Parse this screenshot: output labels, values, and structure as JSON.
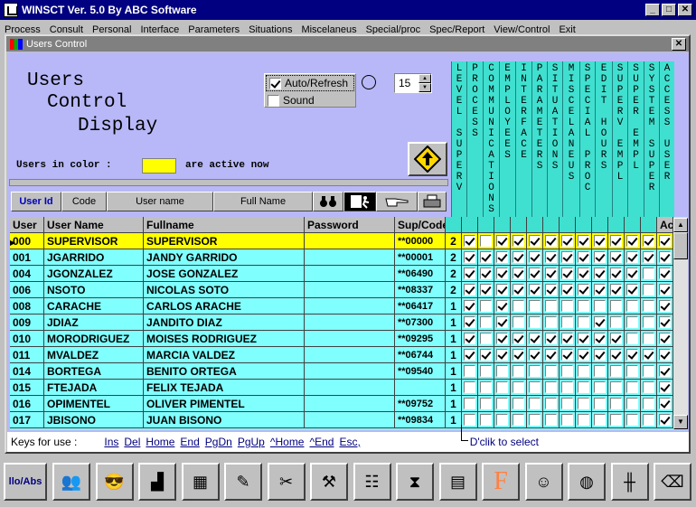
{
  "window": {
    "title": "WINSCT   Ver. 5.0  By ABC Software",
    "min": "_",
    "max": "□",
    "close": "✕"
  },
  "menu": [
    "Process",
    "Consult",
    "Personal",
    "Interface",
    "Parameters",
    "Situations",
    "Miscelaneus",
    "Special/proc",
    "Spec/Report",
    "View/Control",
    "Exit"
  ],
  "child": {
    "title": "Users Control",
    "close": "✕"
  },
  "heading": {
    "line1": "Users",
    "line2": "Control",
    "line3": "Display"
  },
  "options": {
    "auto_refresh": "Auto/Refresh",
    "sound": "Sound",
    "interval": "15"
  },
  "legend": {
    "prefix": "Users in color :",
    "suffix": "are active now",
    "color": "#ffff00"
  },
  "buttons": {
    "user_id": "User Id",
    "code": "Code",
    "user_name": "User name",
    "full_name": "Full Name"
  },
  "perm_headers": [
    "LEVEL SUPERV",
    "PROCESS",
    "COMMUNICATIONS",
    "EMPLOYEES",
    "INTERFACE",
    "PARAMETERS",
    "SITUATIONS",
    "MISCELANEUS",
    "SPECIAL PROC",
    "EDIT HOURS",
    "SUPERV EMPL",
    "SUPER EMPL",
    "SYSTEM SUPER",
    "ACCESS USER"
  ],
  "columns": {
    "user": "User",
    "user_name": "User Name",
    "fullname": "Fullname",
    "password": "Password",
    "sup_code": "Sup/Code",
    "access": "Ac"
  },
  "rows": [
    {
      "user": "000",
      "username": "SUPERVISOR",
      "fullname": "SUPERVISOR",
      "code": "**00000",
      "level": "2",
      "perms": [
        1,
        0,
        1,
        1,
        1,
        1,
        1,
        1,
        1,
        1,
        1,
        1,
        1
      ]
    },
    {
      "user": "001",
      "username": "JGARRIDO",
      "fullname": "JANDY GARRIDO",
      "code": "**00001",
      "level": "2",
      "perms": [
        1,
        1,
        1,
        1,
        1,
        1,
        1,
        1,
        1,
        1,
        1,
        1,
        1
      ]
    },
    {
      "user": "004",
      "username": "JGONZALEZ",
      "fullname": "JOSE GONZALEZ",
      "code": "**06490",
      "level": "2",
      "perms": [
        1,
        1,
        1,
        1,
        1,
        1,
        1,
        1,
        1,
        1,
        1,
        0,
        1
      ]
    },
    {
      "user": "006",
      "username": "NSOTO",
      "fullname": "NICOLAS SOTO",
      "code": "**08337",
      "level": "2",
      "perms": [
        1,
        1,
        1,
        1,
        1,
        1,
        1,
        1,
        1,
        1,
        1,
        0,
        1
      ]
    },
    {
      "user": "008",
      "username": "CARACHE",
      "fullname": "CARLOS ARACHE",
      "code": "**06417",
      "level": "1",
      "perms": [
        1,
        0,
        1,
        0,
        0,
        0,
        0,
        0,
        0,
        0,
        0,
        0,
        1
      ]
    },
    {
      "user": "009",
      "username": "JDIAZ",
      "fullname": "JANDITO DIAZ",
      "code": "**07300",
      "level": "1",
      "perms": [
        1,
        0,
        1,
        0,
        0,
        0,
        0,
        0,
        1,
        0,
        0,
        0,
        1
      ]
    },
    {
      "user": "010",
      "username": "MORODRIGUEZ",
      "fullname": "MOISES RODRIGUEZ",
      "code": "**09295",
      "level": "1",
      "perms": [
        1,
        0,
        1,
        1,
        1,
        1,
        1,
        1,
        1,
        1,
        0,
        0,
        1
      ]
    },
    {
      "user": "011",
      "username": "MVALDEZ",
      "fullname": "MARCIA VALDEZ",
      "code": "**06744",
      "level": "1",
      "perms": [
        1,
        1,
        1,
        1,
        1,
        1,
        1,
        1,
        1,
        1,
        1,
        1,
        1
      ]
    },
    {
      "user": "014",
      "username": "BORTEGA",
      "fullname": "BENITO ORTEGA",
      "code": "**09540",
      "level": "1",
      "perms": [
        0,
        0,
        0,
        0,
        0,
        0,
        0,
        0,
        0,
        0,
        0,
        0,
        1
      ]
    },
    {
      "user": "015",
      "username": "FTEJADA",
      "fullname": "FELIX TEJADA",
      "code": "",
      "level": "1",
      "perms": [
        0,
        0,
        0,
        0,
        0,
        0,
        0,
        0,
        0,
        0,
        0,
        0,
        1
      ]
    },
    {
      "user": "016",
      "username": "OPIMENTEL",
      "fullname": "OLIVER PIMENTEL",
      "code": "**09752",
      "level": "1",
      "perms": [
        0,
        0,
        0,
        0,
        0,
        0,
        0,
        0,
        0,
        0,
        0,
        0,
        1
      ]
    },
    {
      "user": "017",
      "username": "JBISONO",
      "fullname": "JUAN BISONO",
      "code": "**09834",
      "level": "1",
      "perms": [
        0,
        0,
        0,
        0,
        0,
        0,
        0,
        0,
        0,
        0,
        0,
        0,
        1
      ]
    }
  ],
  "footer": {
    "label": "Keys for use :",
    "keys": [
      "Ins",
      "Del",
      "Home",
      "End",
      "PgDn",
      "PgUp",
      "^Home",
      "^End",
      "Esc,"
    ],
    "hint": "D'clik to select"
  },
  "taskbar": {
    "first": "llo/Abs"
  }
}
